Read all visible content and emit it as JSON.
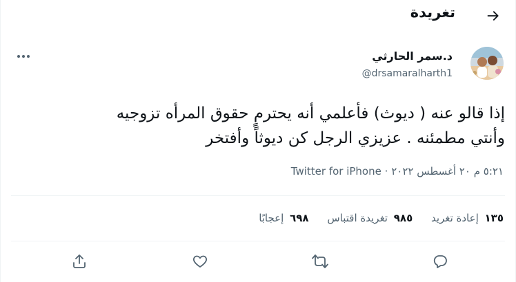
{
  "header": {
    "title": "تغريدة"
  },
  "tweet": {
    "author": {
      "display_name": "د.سمر الحارثي",
      "handle": "@drsamaralharth1"
    },
    "text_lines": [
      "إذا قالو عنه ( ديوث) فأعلمي أنه يحترمٍ حقوق المرأه تزوجيه",
      "وأنتي مطمئنه . عزيزي الرجل كن ديوثاً وأفتخر"
    ],
    "time": "٥:٢١ م",
    "date": "٢٠ أغسطس ٢٠٢٢",
    "separator": "·",
    "source": "Twitter for iPhone"
  },
  "stats": {
    "retweets": {
      "count": "١٣٥",
      "label": "إعادة تغريد"
    },
    "quotes": {
      "count": "٩٨٥",
      "label": "تغريدة اقتباس"
    },
    "likes": {
      "count": "٦٩٨",
      "label": "إعجابًا"
    }
  },
  "icons": {
    "back": "arrow-icon",
    "more": "more-horizontal-icon",
    "reply": "reply-icon",
    "retweet": "retweet-icon",
    "like": "heart-icon",
    "share": "share-icon"
  },
  "colors": {
    "text": "#0f1419",
    "secondary": "#536471",
    "border": "#eff3f4"
  }
}
